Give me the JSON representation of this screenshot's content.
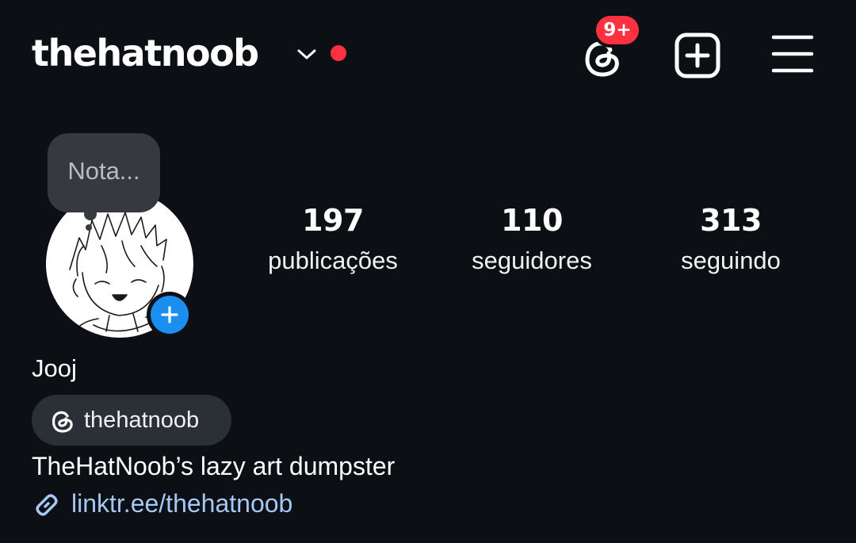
{
  "header": {
    "username": "thehatnoob",
    "notification_badge": "9+",
    "icons": {
      "account_switcher": "chevron-down-icon",
      "threads": "threads-icon",
      "create": "plus-square-icon",
      "menu": "hamburger-menu-icon"
    }
  },
  "profile": {
    "note_placeholder": "Nota...",
    "stats": [
      {
        "value": "197",
        "label": "publicações"
      },
      {
        "value": "110",
        "label": "seguidores"
      },
      {
        "value": "313",
        "label": "seguindo"
      }
    ],
    "display_name": "Jooj",
    "threads_handle": "thehatnoob",
    "bio": "TheHatNoob’s lazy art dumpster",
    "link": "linktr.ee/thehatnoob"
  },
  "colors": {
    "background": "#0c0f14",
    "badge": "#ff3040",
    "add_button": "#1a8ff0",
    "link": "#a5c8f7",
    "chip": "#2b2f36",
    "note_bubble": "#363a40"
  }
}
